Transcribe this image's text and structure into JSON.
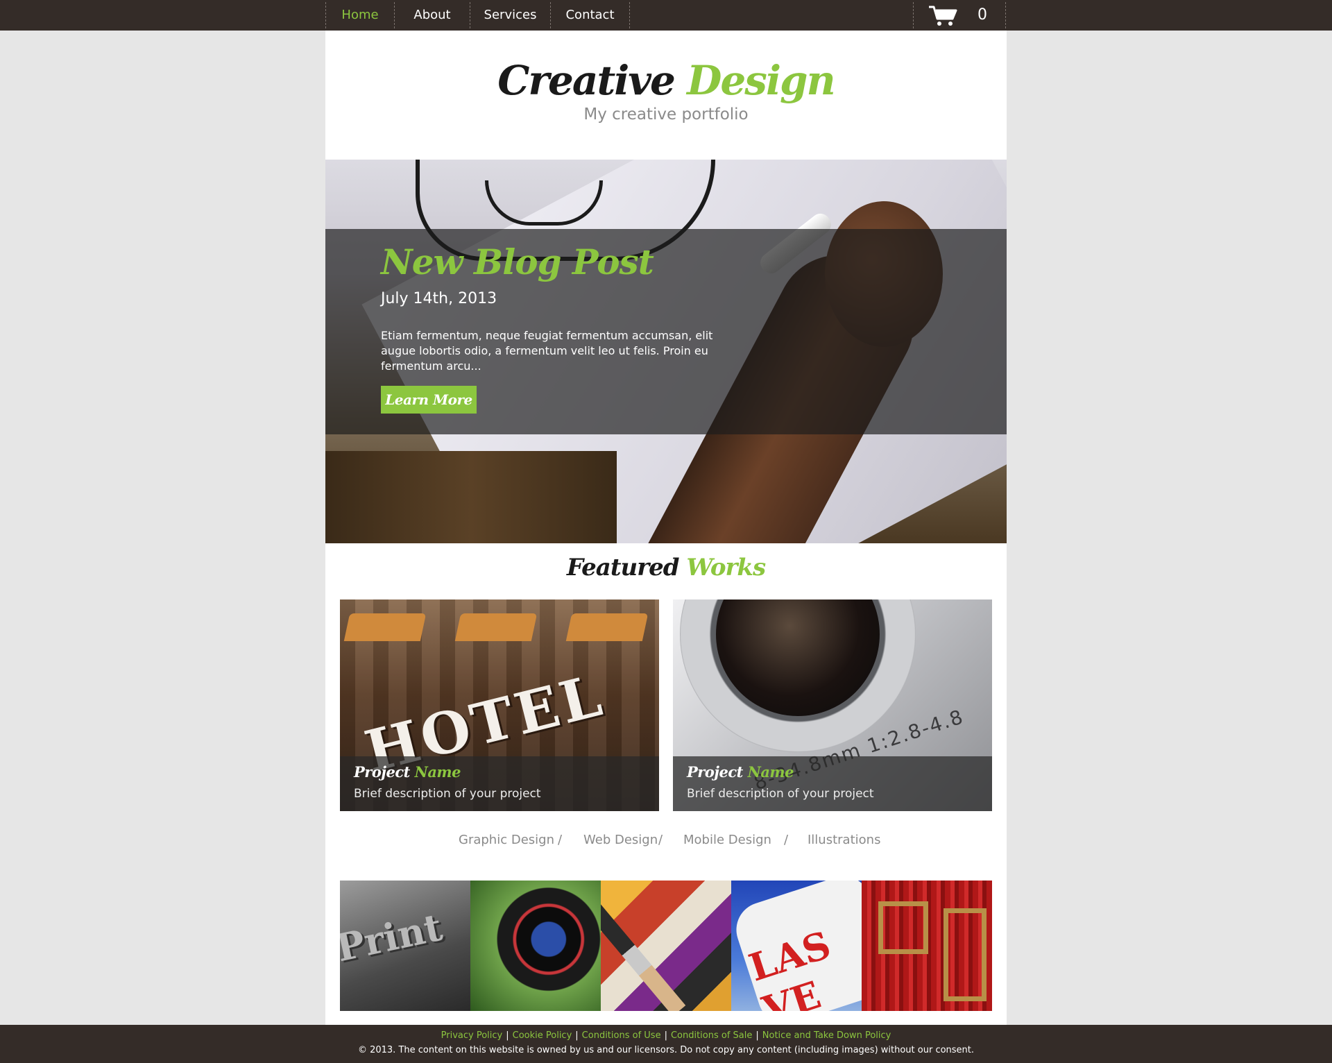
{
  "nav": {
    "items": [
      {
        "label": "Home",
        "active": true
      },
      {
        "label": "About",
        "active": false
      },
      {
        "label": "Services",
        "active": false
      },
      {
        "label": "Contact",
        "active": false
      }
    ],
    "cart_count": "0",
    "cart_icon": "cart-icon"
  },
  "header": {
    "logo_part1": "Creative",
    "logo_part2": "Design",
    "tagline": "My creative portfolio"
  },
  "hero": {
    "title": "New Blog Post",
    "date": "July 14th, 2013",
    "text": "Etiam fermentum, neque feugiat fermentum accumsan, elit augue lobortis odio, a fermentum velit leo ut felis. Proin eu fermentum arcu...",
    "button_label": "Learn More"
  },
  "featured": {
    "title_part1": "Featured",
    "title_part2": "Works",
    "projects": [
      {
        "title_part1": "Project",
        "title_part2": "Name",
        "description": "Brief description of your project",
        "image_text": "HOTEL"
      },
      {
        "title_part1": "Project",
        "title_part2": "Name",
        "description": "Brief description of your project",
        "image_text": "8-34.8mm 1:2.8-4.8"
      }
    ]
  },
  "categories": {
    "items": [
      "Graphic Design",
      "Web Design",
      "Mobile Design",
      "Illustrations"
    ],
    "separator": "/"
  },
  "thumbnails": {
    "items": [
      {
        "image_text": "Print"
      },
      {
        "image_text": ""
      },
      {
        "image_text": ""
      },
      {
        "image_text": "LAS VE"
      },
      {
        "image_text": ""
      }
    ]
  },
  "footer": {
    "links": [
      "Privacy Policy",
      "Cookie Policy",
      "Conditions of Use",
      "Conditions of Sale",
      "Notice and Take Down Policy"
    ],
    "link_separator": "|",
    "copyright": "© 2013. The content on this website is owned by us and our licensors. Do not copy any content (including images) without our consent."
  },
  "colors": {
    "accent": "#8cc63f",
    "nav_bg": "#342c28",
    "page_bg": "#e6e6e6"
  }
}
